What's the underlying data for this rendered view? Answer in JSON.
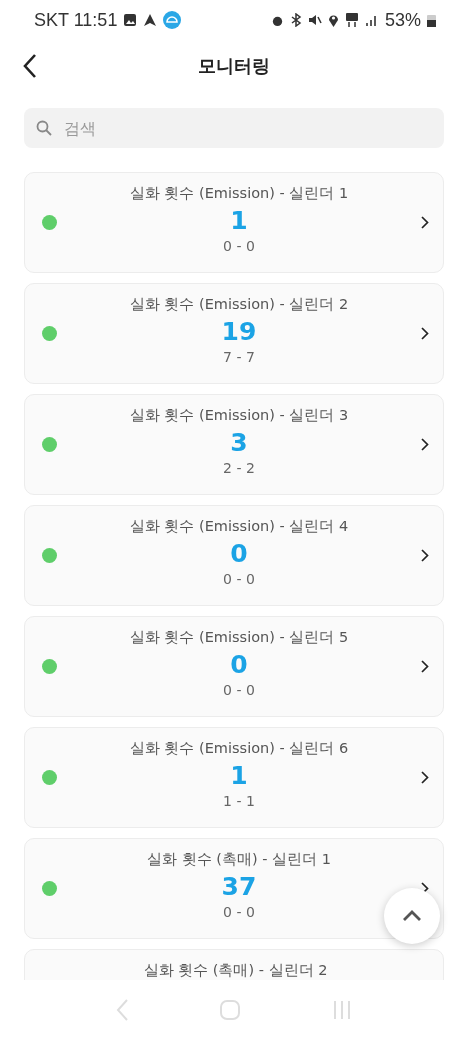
{
  "status_bar": {
    "carrier_time": "SKT 11:51",
    "battery": "53%"
  },
  "header": {
    "title": "모니터링"
  },
  "search": {
    "placeholder": "검색"
  },
  "items": [
    {
      "title": "실화 횟수 (Emission) - 실린더 1",
      "value": "1",
      "range": "0 - 0",
      "color": "#5fce6a"
    },
    {
      "title": "실화 횟수 (Emission) - 실린더 2",
      "value": "19",
      "range": "7 - 7",
      "color": "#5fce6a"
    },
    {
      "title": "실화 횟수 (Emission) - 실린더 3",
      "value": "3",
      "range": "2 - 2",
      "color": "#5fce6a"
    },
    {
      "title": "실화 횟수 (Emission) - 실린더 4",
      "value": "0",
      "range": "0 - 0",
      "color": "#5fce6a"
    },
    {
      "title": "실화 횟수 (Emission) - 실린더 5",
      "value": "0",
      "range": "0 - 0",
      "color": "#5fce6a"
    },
    {
      "title": "실화 횟수 (Emission) - 실린더 6",
      "value": "1",
      "range": "1 - 1",
      "color": "#5fce6a"
    },
    {
      "title": "실화 횟수 (촉매) - 실린더 1",
      "value": "37",
      "range": "0 - 0",
      "color": "#5fce6a"
    },
    {
      "title": "실화 횟수 (촉매) - 실린더 2"
    }
  ]
}
